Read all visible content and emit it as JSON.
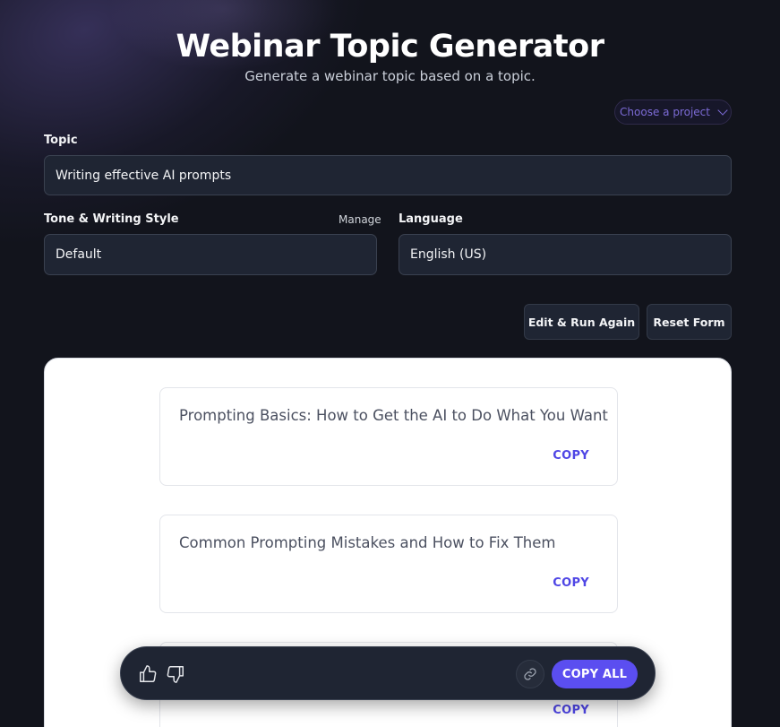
{
  "header": {
    "title": "Webinar Topic Generator",
    "subtitle": "Generate a webinar topic based on a topic."
  },
  "project_select": {
    "placeholder": "Choose a project"
  },
  "form": {
    "topic": {
      "label": "Topic",
      "value": "Writing effective AI prompts"
    },
    "tone": {
      "label": "Tone & Writing Style",
      "manage_label": "Manage",
      "value": "Default"
    },
    "language": {
      "label": "Language",
      "value": "English (US)"
    }
  },
  "actions": {
    "edit_run_label": "Edit & Run Again",
    "reset_label": "Reset Form"
  },
  "results": [
    {
      "text": "Prompting Basics: How to Get the AI to Do What You Want",
      "copy_label": "COPY"
    },
    {
      "text": "Common Prompting Mistakes and How to Fix Them",
      "copy_label": "COPY"
    },
    {
      "text": "",
      "copy_label": "COPY"
    }
  ],
  "toolbar": {
    "thumbs_up_icon": "thumbs-up-icon",
    "thumbs_down_icon": "thumbs-down-icon",
    "link_icon": "link-icon",
    "copy_all_label": "COPY ALL"
  },
  "colors": {
    "accent": "#5b4ef0",
    "copy_text": "#4f46e5",
    "background": "#12141c",
    "field_bg": "#1f2533"
  }
}
